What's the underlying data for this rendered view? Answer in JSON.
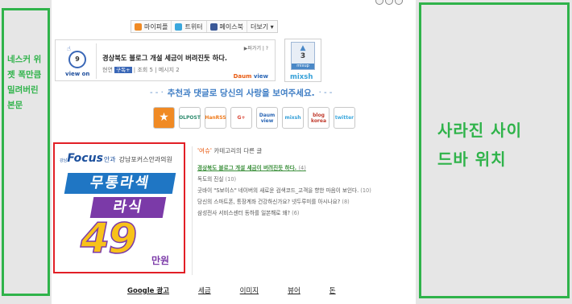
{
  "left_placeholder": {
    "lines": [
      "네스커 위",
      "젯 폭만큼",
      "밀려버린",
      "본문"
    ]
  },
  "right_placeholder": {
    "lines": [
      "사라진 사이",
      "드바 위치"
    ]
  },
  "share_bar": {
    "buttons": [
      {
        "label": "마이피플",
        "icon": "mypeople-icon",
        "color": "#f08a24"
      },
      {
        "label": "트위터",
        "icon": "twitter-icon",
        "color": "#3aa7dd"
      },
      {
        "label": "페이스북",
        "icon": "facebook-icon",
        "color": "#3b5998"
      },
      {
        "label": "더보기 ▾",
        "icon": "",
        "color": ""
      }
    ]
  },
  "daum_view": {
    "vote_count": "9",
    "vote_label": "view on",
    "post_title": "경상북도 블로그 개설 세금이 버려진듯 하다.",
    "meta_prefix": "현연",
    "meta_tag": "구독+",
    "meta_rest": "| 조회 5 | 메시지 2",
    "top_link": "▶퍼가기 | ?",
    "logo_daum": "Daum",
    "logo_view": "view"
  },
  "mixsh": {
    "count": "3",
    "mini": "mixup",
    "name": "mixsh"
  },
  "recommend_text": "추천과 댓글로 당신의 사랑을 보여주세요.",
  "sns_icons": [
    {
      "name": "star-icon",
      "text": "★",
      "bg": "#f08a24",
      "fg": "#ffffff"
    },
    {
      "name": "olpost-icon",
      "text": "OLPOST",
      "bg": "#ffffff",
      "fg": "#2d8b6e"
    },
    {
      "name": "hanrss-icon",
      "text": "HanRSS",
      "bg": "#ffffff",
      "fg": "#f07c1e"
    },
    {
      "name": "google-icon",
      "text": "G+",
      "bg": "#ffffff",
      "fg": "#d94737"
    },
    {
      "name": "daumview-icon",
      "text": "Daum view",
      "bg": "#ffffff",
      "fg": "#2a66b5"
    },
    {
      "name": "mixsh-icon",
      "text": "mixsh",
      "bg": "#ffffff",
      "fg": "#35a0d8"
    },
    {
      "name": "blogkorea-icon",
      "text": "blog korea",
      "bg": "#ffffff",
      "fg": "#c0392b"
    },
    {
      "name": "twitter-icon",
      "text": "twitter",
      "bg": "#ffffff",
      "fg": "#3aa7dd"
    }
  ],
  "ad": {
    "brand_small": "강남",
    "brand_focus": "Focus",
    "brand_inkwa": "안과",
    "clinic_name": "강남포커스안과의원",
    "line1": "무통라섹",
    "line2": "라식",
    "price": "49",
    "unit": "만원"
  },
  "related": {
    "category": "'여슈'",
    "header_rest": " 카테고리의 다른 글",
    "items": [
      {
        "title": "경상북도 블로그 개설 세금이 버려진듯 하다.",
        "count": "(4)",
        "highlight": true
      },
      {
        "title": "독도의 진실",
        "count": "(10)",
        "highlight": false
      },
      {
        "title": "굿바이 \"S보이스\" 네이버의 새로운 검색코드_고객을 향한 마음이 보인다.",
        "count": "(10)",
        "highlight": false
      },
      {
        "title": "당신의 스마트폰, 통장계좌 건강하신가요? 넷두루미를 아시나요?",
        "count": "(8)",
        "highlight": false
      },
      {
        "title": "삼성전사 서비스센터 동하를 일본해로 왜?",
        "count": "(6)",
        "highlight": false
      }
    ]
  },
  "footer": {
    "google_ads": "Google 광고",
    "links": [
      "세금",
      "이미지",
      "뷰어",
      "돈"
    ]
  }
}
